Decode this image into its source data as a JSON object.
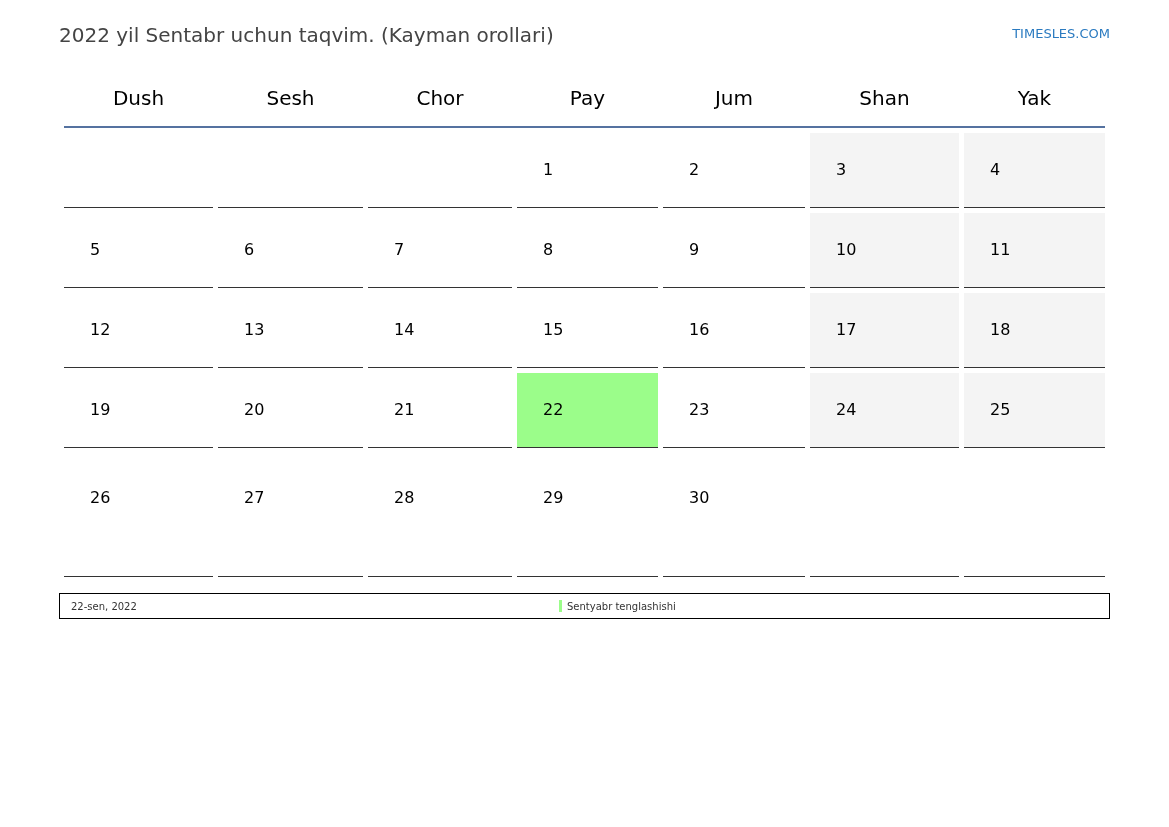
{
  "title": "2022 yil Sentabr uchun taqvim. (Kayman orollari)",
  "brand": "TIMESLES.COM",
  "weekdays": [
    "Dush",
    "Sesh",
    "Chor",
    "Pay",
    "Jum",
    "Shan",
    "Yak"
  ],
  "weeks": [
    [
      {
        "kind": "empty"
      },
      {
        "kind": "empty"
      },
      {
        "kind": "empty"
      },
      {
        "kind": "weekday",
        "day": "1"
      },
      {
        "kind": "weekday",
        "day": "2"
      },
      {
        "kind": "weekend",
        "day": "3"
      },
      {
        "kind": "weekend",
        "day": "4"
      }
    ],
    [
      {
        "kind": "weekday",
        "day": "5"
      },
      {
        "kind": "weekday",
        "day": "6"
      },
      {
        "kind": "weekday",
        "day": "7"
      },
      {
        "kind": "weekday",
        "day": "8"
      },
      {
        "kind": "weekday",
        "day": "9"
      },
      {
        "kind": "weekend",
        "day": "10"
      },
      {
        "kind": "weekend",
        "day": "11"
      }
    ],
    [
      {
        "kind": "weekday",
        "day": "12"
      },
      {
        "kind": "weekday",
        "day": "13"
      },
      {
        "kind": "weekday",
        "day": "14"
      },
      {
        "kind": "weekday",
        "day": "15"
      },
      {
        "kind": "weekday",
        "day": "16"
      },
      {
        "kind": "weekend",
        "day": "17"
      },
      {
        "kind": "weekend",
        "day": "18"
      }
    ],
    [
      {
        "kind": "weekday",
        "day": "19"
      },
      {
        "kind": "weekday",
        "day": "20"
      },
      {
        "kind": "weekday",
        "day": "21"
      },
      {
        "kind": "weekday",
        "day": "22",
        "color": "#9bfd8a"
      },
      {
        "kind": "weekday",
        "day": "23"
      },
      {
        "kind": "weekend",
        "day": "24"
      },
      {
        "kind": "weekend",
        "day": "25"
      }
    ],
    [
      {
        "kind": "weekday",
        "day": "26"
      },
      {
        "kind": "weekday",
        "day": "27"
      },
      {
        "kind": "weekday",
        "day": "28"
      },
      {
        "kind": "weekday",
        "day": "29"
      },
      {
        "kind": "weekday",
        "day": "30"
      },
      {
        "kind": "empty"
      },
      {
        "kind": "empty"
      }
    ]
  ],
  "events": [
    {
      "date": "22-sen, 2022",
      "name": "Sentyabr tenglashishi",
      "color": "#9bfd8a"
    }
  ]
}
